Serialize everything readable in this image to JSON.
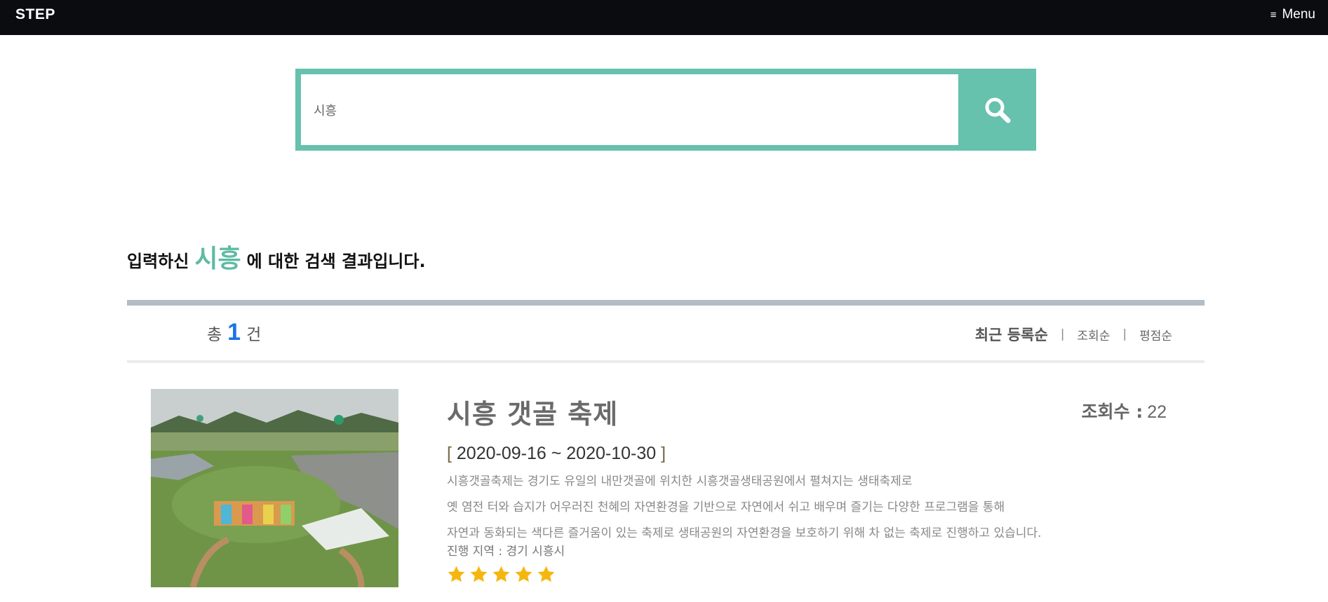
{
  "nav": {
    "brand": "STEP",
    "menu_label": "Menu",
    "menu_icon": "hamburger-icon"
  },
  "search": {
    "value": "시흥",
    "button_icon": "search-icon"
  },
  "result_heading": {
    "prefix": "입력하신",
    "keyword": "시흥",
    "suffix": "에 대한 검색 결과입니다."
  },
  "total": {
    "prefix": "총",
    "count": "1",
    "suffix": "건"
  },
  "sort": {
    "options": [
      "최근 등록순",
      "조회순",
      "평점순"
    ],
    "separator": "|",
    "active_index": 0
  },
  "items": [
    {
      "title": "시흥 갯골 축제",
      "views_label": "조회수 :",
      "views": "22",
      "period_open": "[",
      "period": "2020-09-16 ~ 2020-10-30",
      "period_close": "]",
      "description": [
        "시흥갯골축제는 경기도 유일의 내만갯골에 위치한 시흥갯골생태공원에서 펼쳐지는 생태축제로",
        "옛 염전 터와 습지가 어우러진 천혜의 자연환경을 기반으로 자연에서 쉬고 배우며 즐기는 다양한 프로그램을 통해",
        "자연과 동화되는 색다른 즐거움이 있는 축제로 생태공원의 자연환경을 보호하기 위해 차 없는 축제로 진행하고 있습니다."
      ],
      "region": "진행 지역 : 경기 시흥시",
      "rating": 5
    }
  ],
  "colors": {
    "nav_bg": "#0b0c10",
    "accent": "#66c1ad",
    "count": "#1a73e8",
    "star": "#f5b70f"
  }
}
